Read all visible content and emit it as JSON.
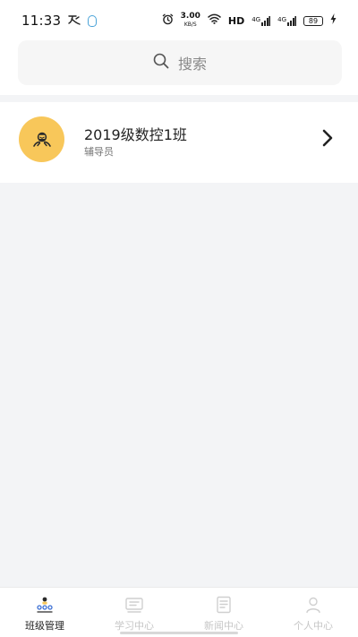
{
  "status_bar": {
    "time": "11:33",
    "net_speed_value": "3.00",
    "net_speed_unit": "KB/S",
    "hd": "HD",
    "signal_1": "4G",
    "signal_2": "4G",
    "battery": "89"
  },
  "search": {
    "label": "搜索",
    "icon": "search-icon"
  },
  "class_list": [
    {
      "name": "2019级数控1班",
      "role": "辅导员",
      "avatar_icon": "class-avatar-icon",
      "avatar_color": "#f8c75a"
    }
  ],
  "tabs": [
    {
      "label": "班级管理",
      "icon": "class-management-icon",
      "active": true
    },
    {
      "label": "学习中心",
      "icon": "study-center-icon",
      "active": false
    },
    {
      "label": "新闻中心",
      "icon": "news-center-icon",
      "active": false
    },
    {
      "label": "个人中心",
      "icon": "profile-icon",
      "active": false
    }
  ],
  "colors": {
    "accent": "#f8c75a",
    "active_tab": "#222222",
    "inactive_tab": "#c6c6c6",
    "qq_blue": "#4aa3d8"
  }
}
